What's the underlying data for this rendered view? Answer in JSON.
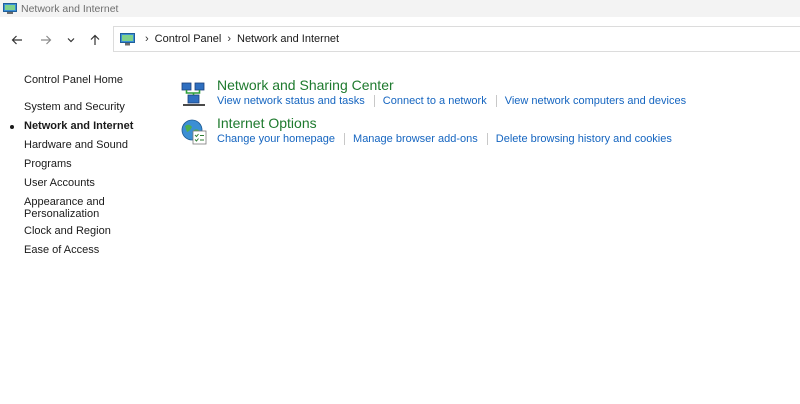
{
  "window": {
    "title": "Network and Internet"
  },
  "address_bar": {
    "breadcrumbs": [
      "Control Panel",
      "Network and Internet"
    ]
  },
  "left_nav": {
    "home": "Control Panel Home",
    "items": [
      {
        "label": "System and Security",
        "active": false
      },
      {
        "label": "Network and Internet",
        "active": true
      },
      {
        "label": "Hardware and Sound",
        "active": false
      },
      {
        "label": "Programs",
        "active": false
      },
      {
        "label": "User Accounts",
        "active": false
      },
      {
        "label": "Appearance and Personalization",
        "active": false
      },
      {
        "label": "Clock and Region",
        "active": false
      },
      {
        "label": "Ease of Access",
        "active": false
      }
    ]
  },
  "categories": [
    {
      "title": "Network and Sharing Center",
      "icon": "network-sharing-icon",
      "links": [
        "View network status and tasks",
        "Connect to a network",
        "View network computers and devices"
      ]
    },
    {
      "title": "Internet Options",
      "icon": "internet-options-icon",
      "links": [
        "Change your homepage",
        "Manage browser add-ons",
        "Delete browsing history and cookies"
      ]
    }
  ],
  "colors": {
    "category_title": "#1e7a2e",
    "link": "#1565c0"
  }
}
